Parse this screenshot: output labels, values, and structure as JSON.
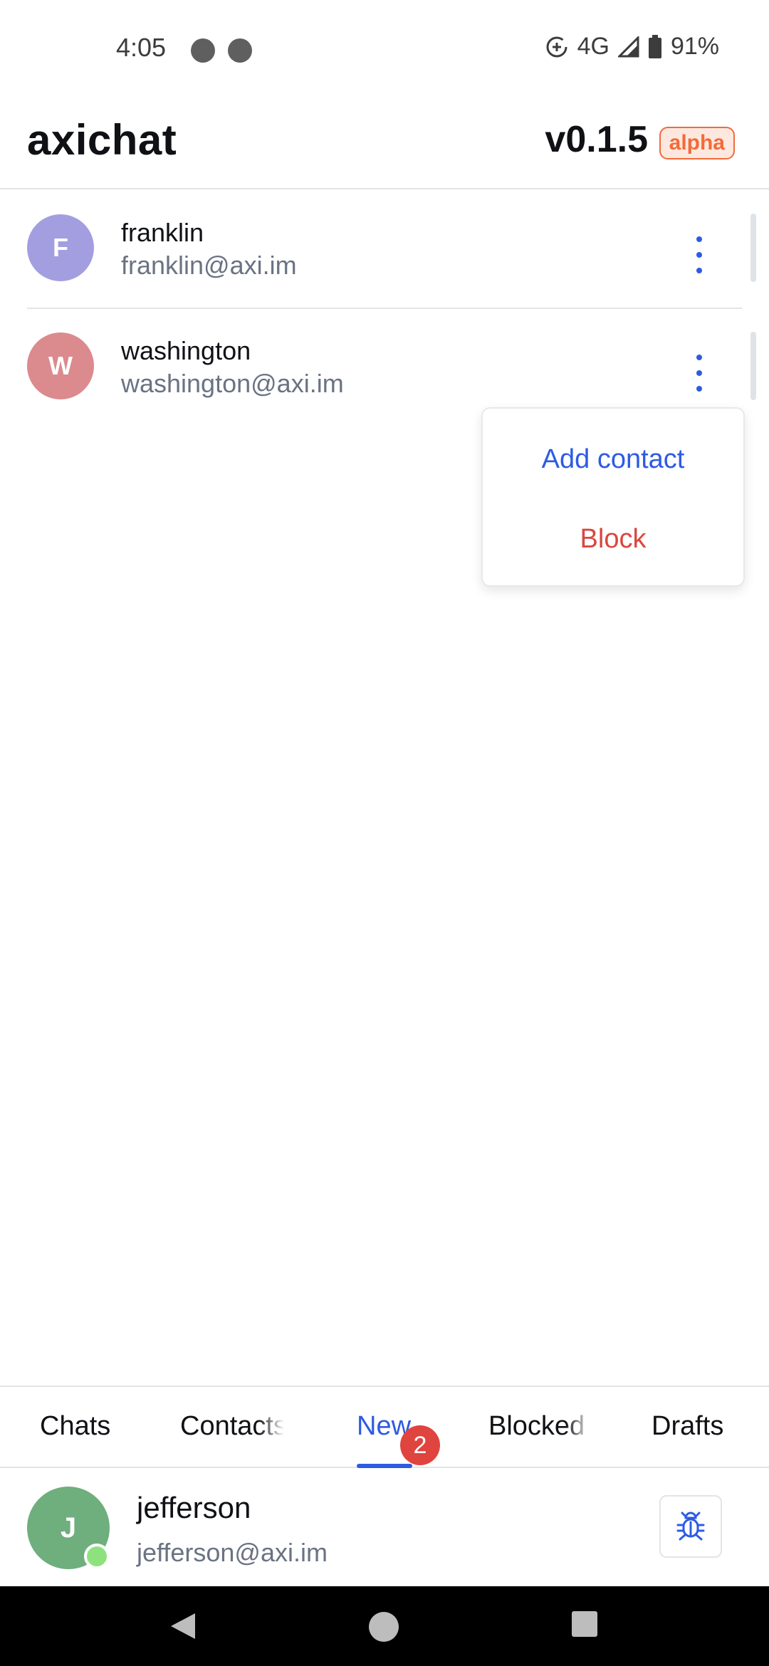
{
  "status_bar": {
    "time": "4:05",
    "network": "4G",
    "battery": "91%"
  },
  "app_bar": {
    "title": "axichat",
    "version": "v0.1.5",
    "badge": "alpha"
  },
  "contacts": [
    {
      "initial": "F",
      "name": "franklin",
      "email": "franklin@axi.im",
      "avatar_color": "#a39ee0"
    },
    {
      "initial": "W",
      "name": "washington",
      "email": "washington@axi.im",
      "avatar_color": "#db8a8e"
    }
  ],
  "menu": {
    "add_contact": "Add contact",
    "block": "Block"
  },
  "tabs": [
    {
      "label": "Chats"
    },
    {
      "label": "Contacts"
    },
    {
      "label": "New",
      "badge": "2",
      "active": true
    },
    {
      "label": "Blocked"
    },
    {
      "label": "Drafts"
    }
  ],
  "account": {
    "initial": "J",
    "name": "jefferson",
    "email": "jefferson@axi.im"
  },
  "colors": {
    "accent": "#2d5be3",
    "danger": "#d9473f",
    "badge": "#e0443e",
    "alpha": "#f26b3a"
  }
}
